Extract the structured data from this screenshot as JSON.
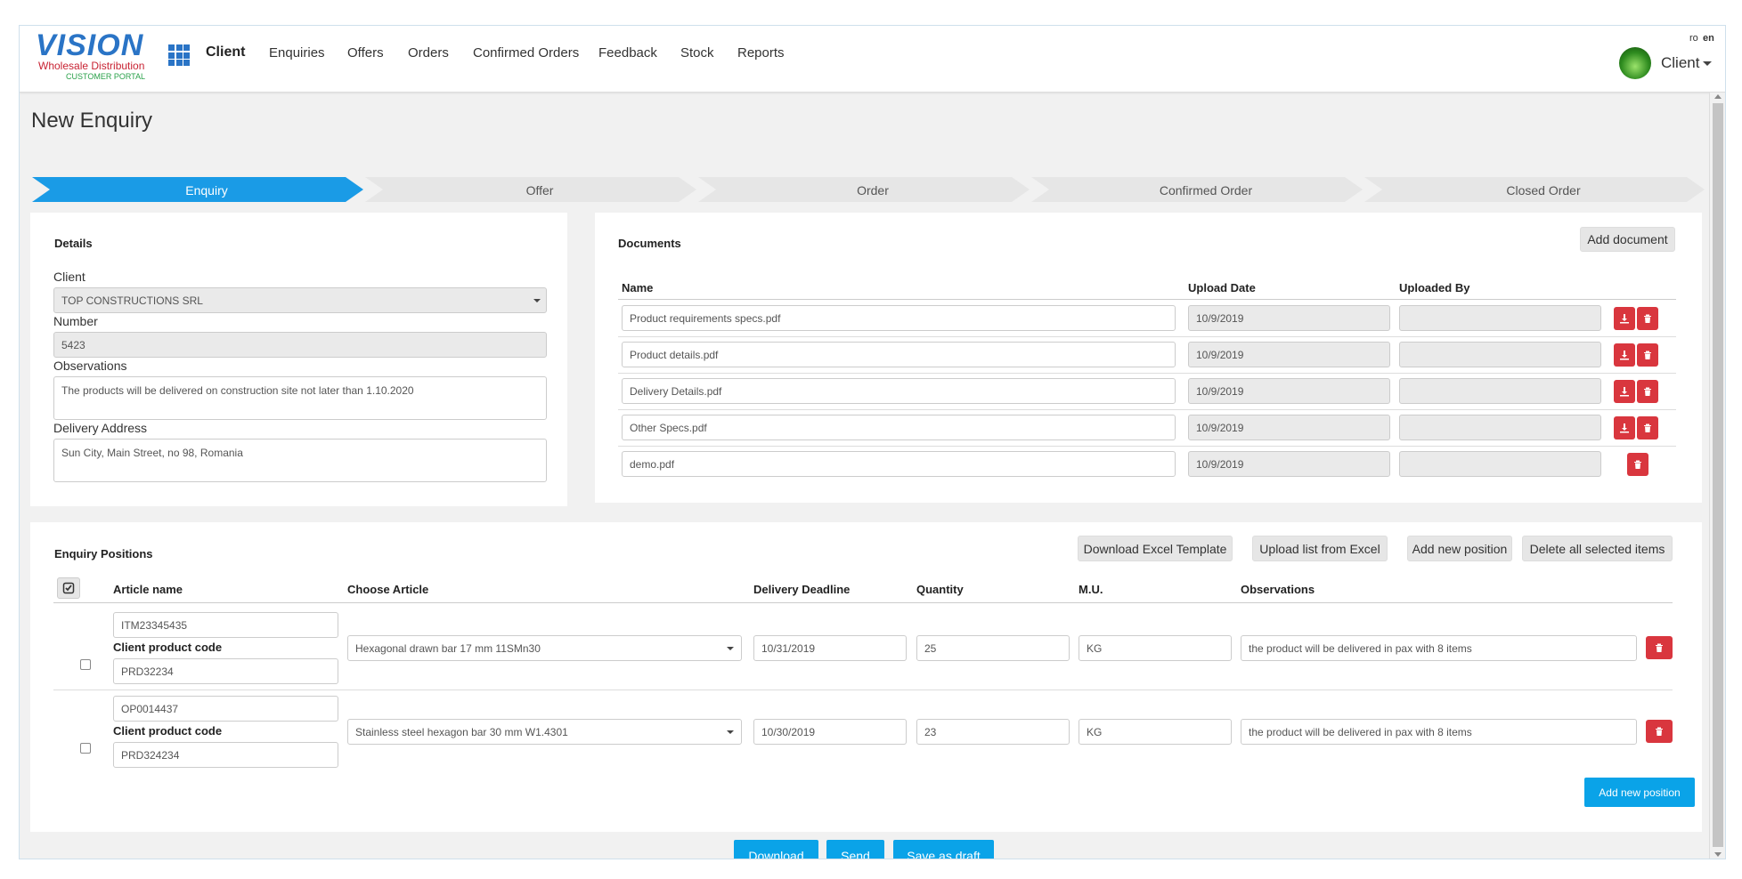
{
  "brand": {
    "name": "VISION",
    "line1": "Wholesale Distribution",
    "line2": "CUSTOMER PORTAL",
    "blue": "#2a74c6",
    "red": "#c82333",
    "green": "#2aa14a"
  },
  "nav": {
    "items": [
      "Client",
      "Enquiries",
      "Offers",
      "Orders",
      "Confirmed Orders",
      "Feedback",
      "Stock",
      "Reports"
    ],
    "active": "Client"
  },
  "lang": {
    "ro": "ro",
    "en": "en",
    "active": "en"
  },
  "user": {
    "name": "Client"
  },
  "page": {
    "title": "New Enquiry"
  },
  "steps": [
    "Enquiry",
    "Offer",
    "Order",
    "Confirmed Order",
    "Closed Order"
  ],
  "active_step": "Enquiry",
  "details": {
    "title": "Details",
    "client_label": "Client",
    "client_value": "TOP CONSTRUCTIONS SRL",
    "number_label": "Number",
    "number_value": "5423",
    "observations_label": "Observations",
    "observations_value": "The products will be delivered on construction site not later than 1.10.2020",
    "address_label": "Delivery Address",
    "address_value": "Sun City, Main Street, no 98, Romania"
  },
  "documents": {
    "title": "Documents",
    "add_label": "Add document",
    "columns": [
      "Name",
      "Upload Date",
      "Uploaded By"
    ],
    "rows": [
      {
        "name": "Product requirements specs.pdf",
        "date": "10/9/2019",
        "by": ""
      },
      {
        "name": "Product details.pdf",
        "date": "10/9/2019",
        "by": ""
      },
      {
        "name": "Delivery Details.pdf",
        "date": "10/9/2019",
        "by": ""
      },
      {
        "name": "Other Specs.pdf",
        "date": "10/9/2019",
        "by": ""
      },
      {
        "name": "demo.pdf",
        "date": "10/9/2019",
        "by": ""
      }
    ]
  },
  "positions": {
    "title": "Enquiry Positions",
    "buttons": [
      "Download Excel Template",
      "Upload list from Excel",
      "Add new position",
      "Delete all selected items"
    ],
    "columns": [
      "Article name",
      "Choose Article",
      "Delivery Deadline",
      "Quantity",
      "M.U.",
      "Observations"
    ],
    "client_code_label": "Client product code",
    "rows": [
      {
        "article": "ITM23345435",
        "client_code": "PRD32234",
        "choose": "Hexagonal drawn bar 17 mm 11SMn30",
        "deadline": "10/31/2019",
        "qty": "25",
        "mu": "KG",
        "obs": "the product will be delivered in pax with 8 items"
      },
      {
        "article": "OP0014437",
        "client_code": "PRD324234",
        "choose": "Stainless steel hexagon bar 30 mm W1.4301",
        "deadline": "10/30/2019",
        "qty": "23",
        "mu": "KG",
        "obs": "the product will be delivered in pax with 8 items"
      }
    ],
    "add_new_label": "Add new position"
  },
  "footer_buttons": [
    "Download",
    "Send",
    "Save as draft"
  ],
  "colors": {
    "accent": "#0aa3e8",
    "danger": "#d9363e",
    "step_active": "#1a9be6",
    "step_inactive": "#e6e6e6"
  },
  "icons": {
    "apps": "grid-icon",
    "download": "download-icon",
    "delete": "trash-icon",
    "select_all": "check-square-icon"
  }
}
